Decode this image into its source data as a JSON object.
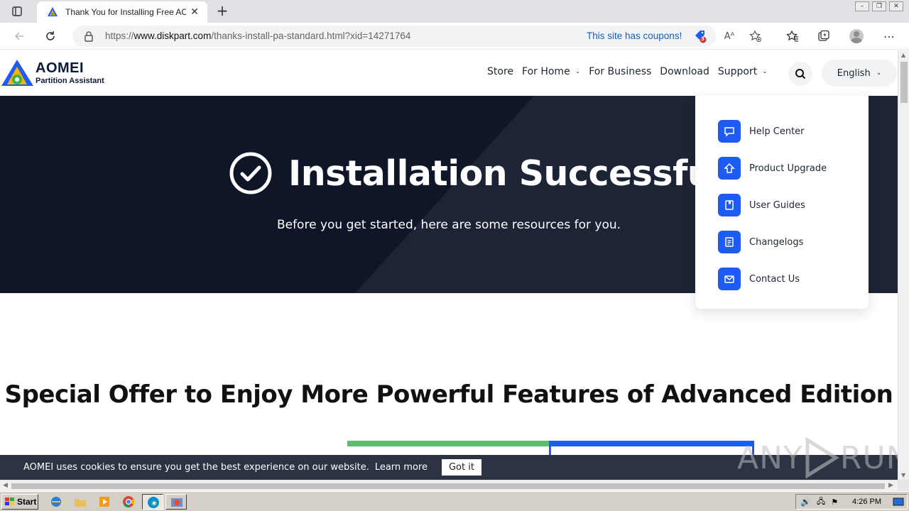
{
  "browser": {
    "tab_title": "Thank You for Installing Free AOMEI Partition Assistant",
    "url_scheme": "https://",
    "url_domain": "www.diskpart.com",
    "url_path": "/thanks-install-pa-standard.html?xid=14271764",
    "coupons_text": "This site has coupons!",
    "coupon_badge": "3",
    "read_aloud_glyph": "Aᴬ"
  },
  "site": {
    "logo_brand": "AOMEI",
    "logo_product": "Partition Assistant",
    "nav": [
      {
        "label": "Store",
        "has_menu": false
      },
      {
        "label": "For Home",
        "has_menu": true
      },
      {
        "label": "For Business",
        "has_menu": false
      },
      {
        "label": "Download",
        "has_menu": false
      },
      {
        "label": "Support",
        "has_menu": true
      }
    ],
    "language": "English",
    "accent_color": "#1e5bf5",
    "hero_bg": "#0f1628"
  },
  "hero": {
    "title": "Installation Successful",
    "subtitle": "Before you get started, here are some resources for you."
  },
  "support_menu": {
    "items": [
      {
        "label": "Help Center",
        "icon": "chat-bubble-icon"
      },
      {
        "label": "Product Upgrade",
        "icon": "upgrade-arrow-icon"
      },
      {
        "label": "User Guides",
        "icon": "book-icon"
      },
      {
        "label": "Changelogs",
        "icon": "document-icon"
      },
      {
        "label": "Contact Us",
        "icon": "mail-icon"
      }
    ]
  },
  "offer": {
    "title": "Special Offer to Enjoy More Powerful Features of Advanced Edition"
  },
  "cookie": {
    "text": "AOMEI uses cookies to ensure you get the best experience on our website.",
    "learn_more": "Learn more",
    "button": "Got it"
  },
  "watermark": {
    "left": "ANY",
    "right": "RUN"
  },
  "taskbar": {
    "start_label": "Start",
    "clock": "4:26 PM"
  }
}
